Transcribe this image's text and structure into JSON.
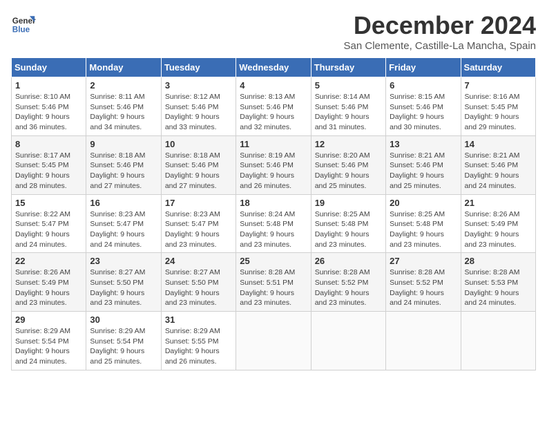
{
  "logo": {
    "name_line1": "General",
    "name_line2": "Blue"
  },
  "header": {
    "month": "December 2024",
    "location": "San Clemente, Castille-La Mancha, Spain"
  },
  "days_of_week": [
    "Sunday",
    "Monday",
    "Tuesday",
    "Wednesday",
    "Thursday",
    "Friday",
    "Saturday"
  ],
  "weeks": [
    [
      {
        "day": "1",
        "sunrise": "Sunrise: 8:10 AM",
        "sunset": "Sunset: 5:46 PM",
        "daylight": "Daylight: 9 hours and 36 minutes."
      },
      {
        "day": "2",
        "sunrise": "Sunrise: 8:11 AM",
        "sunset": "Sunset: 5:46 PM",
        "daylight": "Daylight: 9 hours and 34 minutes."
      },
      {
        "day": "3",
        "sunrise": "Sunrise: 8:12 AM",
        "sunset": "Sunset: 5:46 PM",
        "daylight": "Daylight: 9 hours and 33 minutes."
      },
      {
        "day": "4",
        "sunrise": "Sunrise: 8:13 AM",
        "sunset": "Sunset: 5:46 PM",
        "daylight": "Daylight: 9 hours and 32 minutes."
      },
      {
        "day": "5",
        "sunrise": "Sunrise: 8:14 AM",
        "sunset": "Sunset: 5:46 PM",
        "daylight": "Daylight: 9 hours and 31 minutes."
      },
      {
        "day": "6",
        "sunrise": "Sunrise: 8:15 AM",
        "sunset": "Sunset: 5:46 PM",
        "daylight": "Daylight: 9 hours and 30 minutes."
      },
      {
        "day": "7",
        "sunrise": "Sunrise: 8:16 AM",
        "sunset": "Sunset: 5:45 PM",
        "daylight": "Daylight: 9 hours and 29 minutes."
      }
    ],
    [
      {
        "day": "8",
        "sunrise": "Sunrise: 8:17 AM",
        "sunset": "Sunset: 5:45 PM",
        "daylight": "Daylight: 9 hours and 28 minutes."
      },
      {
        "day": "9",
        "sunrise": "Sunrise: 8:18 AM",
        "sunset": "Sunset: 5:46 PM",
        "daylight": "Daylight: 9 hours and 27 minutes."
      },
      {
        "day": "10",
        "sunrise": "Sunrise: 8:18 AM",
        "sunset": "Sunset: 5:46 PM",
        "daylight": "Daylight: 9 hours and 27 minutes."
      },
      {
        "day": "11",
        "sunrise": "Sunrise: 8:19 AM",
        "sunset": "Sunset: 5:46 PM",
        "daylight": "Daylight: 9 hours and 26 minutes."
      },
      {
        "day": "12",
        "sunrise": "Sunrise: 8:20 AM",
        "sunset": "Sunset: 5:46 PM",
        "daylight": "Daylight: 9 hours and 25 minutes."
      },
      {
        "day": "13",
        "sunrise": "Sunrise: 8:21 AM",
        "sunset": "Sunset: 5:46 PM",
        "daylight": "Daylight: 9 hours and 25 minutes."
      },
      {
        "day": "14",
        "sunrise": "Sunrise: 8:21 AM",
        "sunset": "Sunset: 5:46 PM",
        "daylight": "Daylight: 9 hours and 24 minutes."
      }
    ],
    [
      {
        "day": "15",
        "sunrise": "Sunrise: 8:22 AM",
        "sunset": "Sunset: 5:47 PM",
        "daylight": "Daylight: 9 hours and 24 minutes."
      },
      {
        "day": "16",
        "sunrise": "Sunrise: 8:23 AM",
        "sunset": "Sunset: 5:47 PM",
        "daylight": "Daylight: 9 hours and 24 minutes."
      },
      {
        "day": "17",
        "sunrise": "Sunrise: 8:23 AM",
        "sunset": "Sunset: 5:47 PM",
        "daylight": "Daylight: 9 hours and 23 minutes."
      },
      {
        "day": "18",
        "sunrise": "Sunrise: 8:24 AM",
        "sunset": "Sunset: 5:48 PM",
        "daylight": "Daylight: 9 hours and 23 minutes."
      },
      {
        "day": "19",
        "sunrise": "Sunrise: 8:25 AM",
        "sunset": "Sunset: 5:48 PM",
        "daylight": "Daylight: 9 hours and 23 minutes."
      },
      {
        "day": "20",
        "sunrise": "Sunrise: 8:25 AM",
        "sunset": "Sunset: 5:48 PM",
        "daylight": "Daylight: 9 hours and 23 minutes."
      },
      {
        "day": "21",
        "sunrise": "Sunrise: 8:26 AM",
        "sunset": "Sunset: 5:49 PM",
        "daylight": "Daylight: 9 hours and 23 minutes."
      }
    ],
    [
      {
        "day": "22",
        "sunrise": "Sunrise: 8:26 AM",
        "sunset": "Sunset: 5:49 PM",
        "daylight": "Daylight: 9 hours and 23 minutes."
      },
      {
        "day": "23",
        "sunrise": "Sunrise: 8:27 AM",
        "sunset": "Sunset: 5:50 PM",
        "daylight": "Daylight: 9 hours and 23 minutes."
      },
      {
        "day": "24",
        "sunrise": "Sunrise: 8:27 AM",
        "sunset": "Sunset: 5:50 PM",
        "daylight": "Daylight: 9 hours and 23 minutes."
      },
      {
        "day": "25",
        "sunrise": "Sunrise: 8:28 AM",
        "sunset": "Sunset: 5:51 PM",
        "daylight": "Daylight: 9 hours and 23 minutes."
      },
      {
        "day": "26",
        "sunrise": "Sunrise: 8:28 AM",
        "sunset": "Sunset: 5:52 PM",
        "daylight": "Daylight: 9 hours and 23 minutes."
      },
      {
        "day": "27",
        "sunrise": "Sunrise: 8:28 AM",
        "sunset": "Sunset: 5:52 PM",
        "daylight": "Daylight: 9 hours and 24 minutes."
      },
      {
        "day": "28",
        "sunrise": "Sunrise: 8:28 AM",
        "sunset": "Sunset: 5:53 PM",
        "daylight": "Daylight: 9 hours and 24 minutes."
      }
    ],
    [
      {
        "day": "29",
        "sunrise": "Sunrise: 8:29 AM",
        "sunset": "Sunset: 5:54 PM",
        "daylight": "Daylight: 9 hours and 24 minutes."
      },
      {
        "day": "30",
        "sunrise": "Sunrise: 8:29 AM",
        "sunset": "Sunset: 5:54 PM",
        "daylight": "Daylight: 9 hours and 25 minutes."
      },
      {
        "day": "31",
        "sunrise": "Sunrise: 8:29 AM",
        "sunset": "Sunset: 5:55 PM",
        "daylight": "Daylight: 9 hours and 26 minutes."
      },
      null,
      null,
      null,
      null
    ]
  ]
}
